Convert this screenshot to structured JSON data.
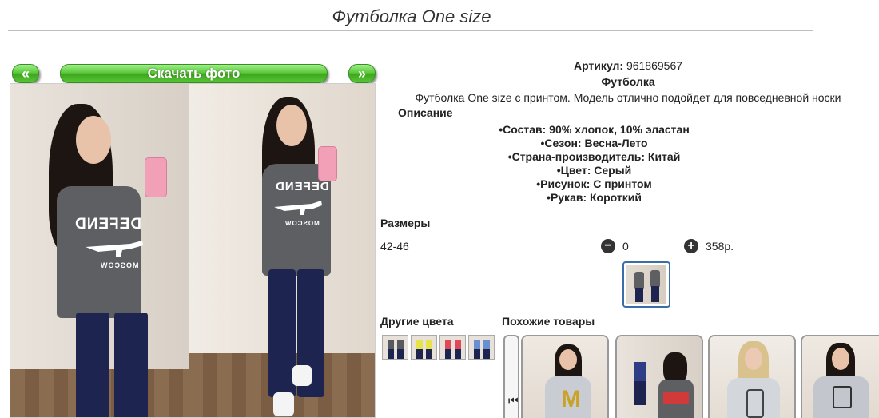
{
  "title": "Футболка One size",
  "gallery": {
    "prev": "«",
    "download": "Скачать фото",
    "next": "»",
    "print_text": "DEFEND",
    "print_sub": "MOSCOW"
  },
  "product": {
    "article_label": "Артикул:",
    "article_value": "961869567",
    "type": "Футболка",
    "description": "Футболка One size с принтом. Модель отлично подойдет для повседневной носки",
    "description_heading": "Описание",
    "specs": [
      "Состав: 90% хлопок, 10% эластан",
      "Сезон: Весна-Лето",
      "Страна-производитель: Китай",
      "Цвет: Серый",
      "Рисунок: С принтом",
      "Рукав: Короткий"
    ]
  },
  "sizes": {
    "heading": "Размеры",
    "rows": [
      {
        "size": "42-46",
        "minus": "−",
        "quantity": "0",
        "plus": "+",
        "price": "358р."
      }
    ]
  },
  "other_colors": {
    "heading": "Другие цвета",
    "colors": [
      "#56595e",
      "#e6e24a",
      "#e04a57",
      "#6a8fd0"
    ]
  },
  "similar": {
    "heading": "Похожие товары",
    "arrow": "⏮"
  },
  "colors": {
    "accent_green": "#4fbf2e",
    "thumb_border": "#3b6ea8"
  }
}
